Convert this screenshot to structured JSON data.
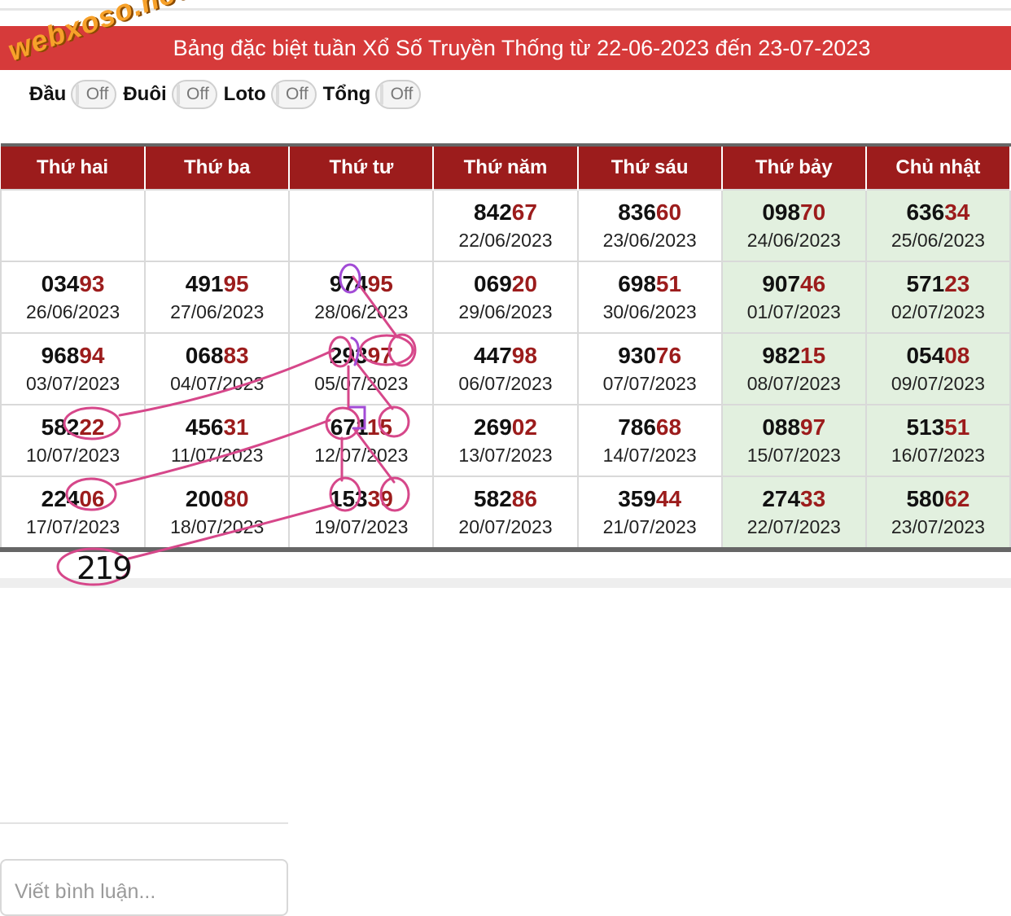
{
  "watermark": "webxoso.net",
  "title": "Bảng đặc biệt tuần Xổ Số Truyền Thống từ 22-06-2023 đến 23-07-2023",
  "toggles": [
    {
      "label": "Đầu",
      "state": "Off"
    },
    {
      "label": "Đuôi",
      "state": "Off"
    },
    {
      "label": "Loto",
      "state": "Off"
    },
    {
      "label": "Tổng",
      "state": "Off"
    }
  ],
  "days": [
    "Thứ hai",
    "Thứ ba",
    "Thứ tư",
    "Thứ năm",
    "Thứ sáu",
    "Thứ bảy",
    "Chủ nhật"
  ],
  "rows": [
    [
      null,
      null,
      null,
      {
        "head": "842",
        "tail": "67",
        "date": "22/06/2023"
      },
      {
        "head": "836",
        "tail": "60",
        "date": "23/06/2023"
      },
      {
        "head": "098",
        "tail": "70",
        "date": "24/06/2023"
      },
      {
        "head": "636",
        "tail": "34",
        "date": "25/06/2023"
      }
    ],
    [
      {
        "head": "034",
        "tail": "93",
        "date": "26/06/2023"
      },
      {
        "head": "491",
        "tail": "95",
        "date": "27/06/2023"
      },
      {
        "head": "974",
        "tail": "95",
        "date": "28/06/2023"
      },
      {
        "head": "069",
        "tail": "20",
        "date": "29/06/2023"
      },
      {
        "head": "698",
        "tail": "51",
        "date": "30/06/2023"
      },
      {
        "head": "907",
        "tail": "46",
        "date": "01/07/2023"
      },
      {
        "head": "571",
        "tail": "23",
        "date": "02/07/2023"
      }
    ],
    [
      {
        "head": "968",
        "tail": "94",
        "date": "03/07/2023"
      },
      {
        "head": "068",
        "tail": "83",
        "date": "04/07/2023"
      },
      {
        "head": "293",
        "tail": "97",
        "date": "05/07/2023"
      },
      {
        "head": "447",
        "tail": "98",
        "date": "06/07/2023"
      },
      {
        "head": "930",
        "tail": "76",
        "date": "07/07/2023"
      },
      {
        "head": "982",
        "tail": "15",
        "date": "08/07/2023"
      },
      {
        "head": "054",
        "tail": "08",
        "date": "09/07/2023"
      }
    ],
    [
      {
        "head": "582",
        "tail": "22",
        "date": "10/07/2023"
      },
      {
        "head": "456",
        "tail": "31",
        "date": "11/07/2023"
      },
      {
        "head": "671",
        "tail": "15",
        "date": "12/07/2023"
      },
      {
        "head": "269",
        "tail": "02",
        "date": "13/07/2023"
      },
      {
        "head": "786",
        "tail": "68",
        "date": "14/07/2023"
      },
      {
        "head": "088",
        "tail": "97",
        "date": "15/07/2023"
      },
      {
        "head": "513",
        "tail": "51",
        "date": "16/07/2023"
      }
    ],
    [
      {
        "head": "224",
        "tail": "06",
        "date": "17/07/2023"
      },
      {
        "head": "200",
        "tail": "80",
        "date": "18/07/2023"
      },
      {
        "head": "153",
        "tail": "39",
        "date": "19/07/2023"
      },
      {
        "head": "582",
        "tail": "86",
        "date": "20/07/2023"
      },
      {
        "head": "359",
        "tail": "44",
        "date": "21/07/2023"
      },
      {
        "head": "274",
        "tail": "33",
        "date": "22/07/2023"
      },
      {
        "head": "580",
        "tail": "62",
        "date": "23/07/2023"
      }
    ]
  ],
  "handwritten_note": "219",
  "comment": {
    "placeholder": "Viết bình luận..."
  },
  "colors": {
    "title_bg": "#d63a3a",
    "header_bg": "#9c1c1c",
    "tail": "#9c1c1c",
    "weekend_bg": "#e2f0df",
    "annotation": "#d6478a",
    "annotation_alt": "#a24bd6"
  }
}
